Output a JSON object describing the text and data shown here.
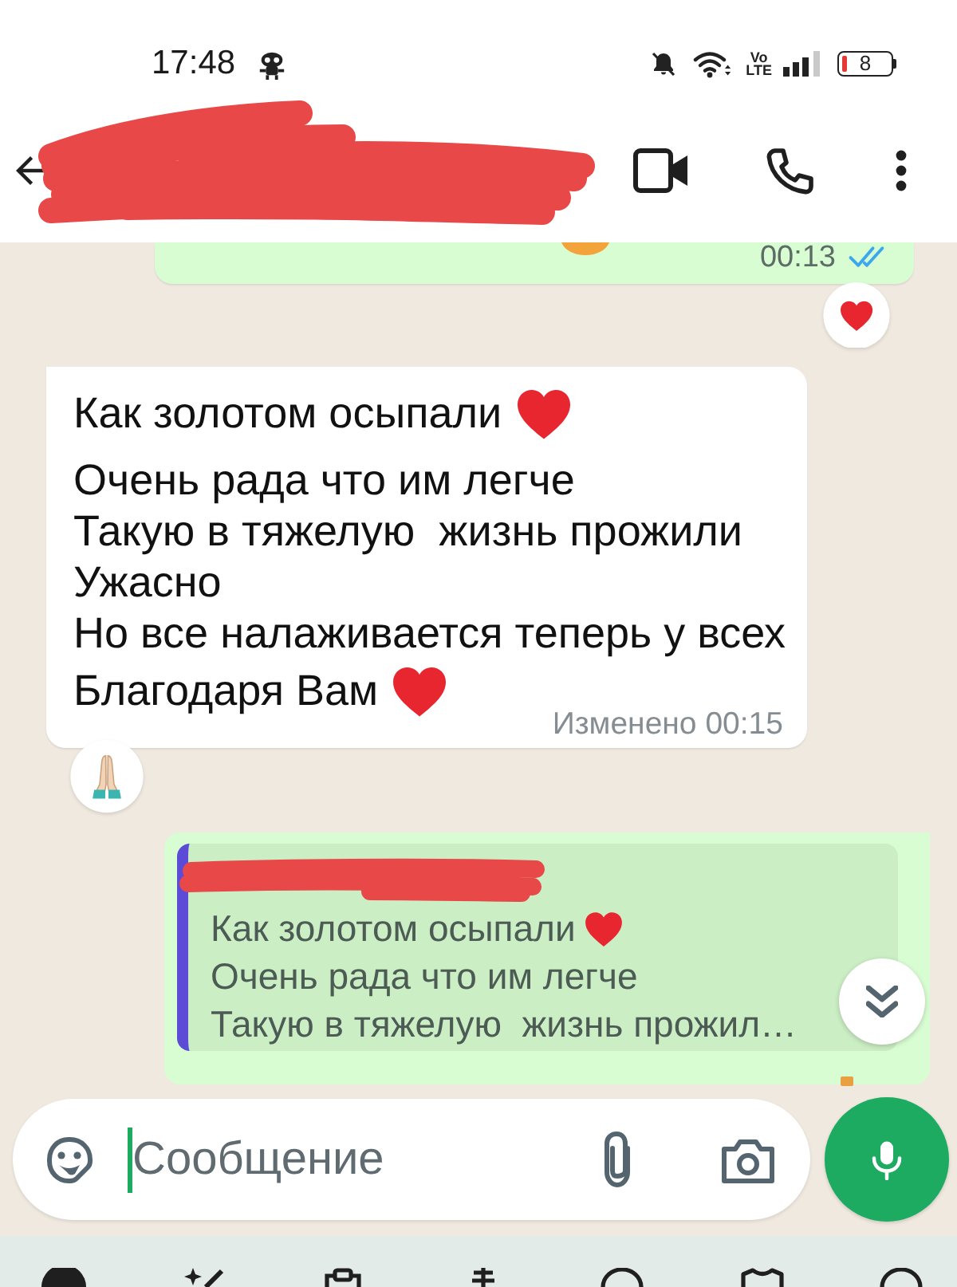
{
  "status_bar": {
    "time": "17:48",
    "network_label": [
      "Vo",
      "LTE"
    ],
    "battery": "8"
  },
  "messages": [
    {
      "kind": "outgoing",
      "time": "00:13",
      "read": true,
      "reaction": true
    },
    {
      "kind": "incoming",
      "lines": [
        {
          "text": "Как золотом осыпали",
          "heart": true
        },
        {
          "text": "Очень рада что им легче",
          "heart": false
        },
        {
          "text": "Такую в тяжелую  жизнь прожили",
          "heart": false
        },
        {
          "text": "Ужасно",
          "heart": false
        },
        {
          "text": "Но все налаживается теперь у всех",
          "heart": false
        },
        {
          "text": "Благодаря Вам",
          "heart": true
        }
      ],
      "meta": "Изменено 00:15",
      "reaction": true
    },
    {
      "kind": "reply",
      "quote_lines": [
        {
          "text": "Как золотом осыпали",
          "heart": true
        },
        {
          "text": "Очень рада что им легче",
          "heart": false
        },
        {
          "text": "Такую в тяжелую  жизнь прожил…",
          "heart": false
        }
      ]
    }
  ],
  "composer": {
    "placeholder": "Сообщение"
  }
}
